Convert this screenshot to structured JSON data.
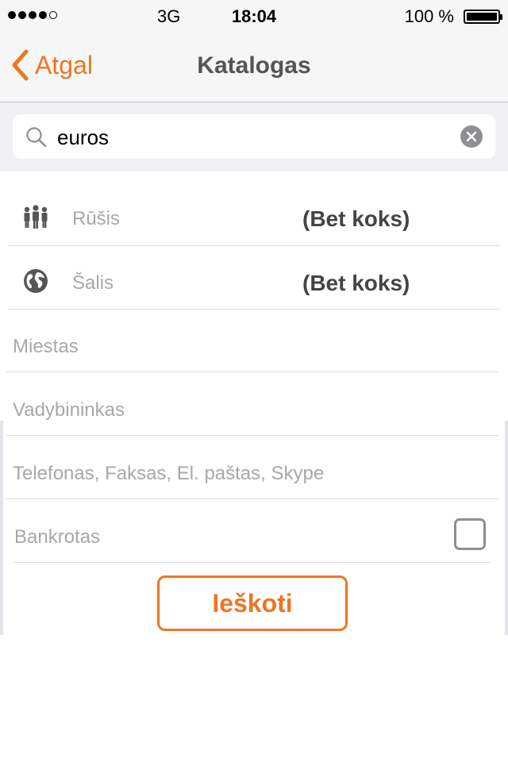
{
  "status_bar": {
    "network": "3G",
    "time": "18:04",
    "battery": "100 %"
  },
  "nav": {
    "back_label": "Atgal",
    "title": "Katalogas"
  },
  "search": {
    "value": "euros"
  },
  "form": {
    "type_label": "Rūšis",
    "type_value": "(Bet koks)",
    "country_label": "Šalis",
    "country_value": "(Bet koks)",
    "city_placeholder": "Miestas",
    "manager_placeholder": "Vadybininkas",
    "contacts_placeholder": "Telefonas, Faksas, El. paštas, Skype",
    "bankrupt_label": "Bankrotas",
    "bankrupt_checked": false
  },
  "actions": {
    "search_button": "Ieškoti"
  },
  "colors": {
    "accent": "#ee7623"
  },
  "icons": [
    "back-chevron-icon",
    "search-icon",
    "clear-icon",
    "people-icon",
    "globe-icon"
  ]
}
